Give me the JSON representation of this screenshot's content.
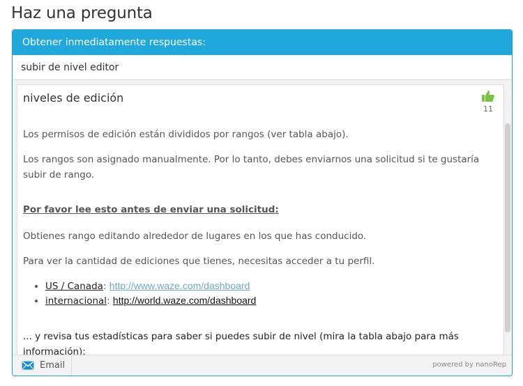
{
  "page": {
    "title": "Haz una pregunta"
  },
  "widget": {
    "header": "Obtener inmediatamente respuestas:",
    "query_value": "subir de nivel editor",
    "answer": {
      "title": "niveles de edición",
      "like_count": "11",
      "paragraphs": [
        "Los permisos de edición están divididos por rangos (ver tabla abajo).",
        "Los rangos son asignado manualmente. Por lo tanto, debes enviarnos una solicitud si te gustaría subir de rango."
      ],
      "notice": "Por favor lee esto antes de enviar una solicitud:",
      "paragraphs_after": [
        "Obtienes rango editando alrededor de lugares en los que has conducido.",
        "Para ver la cantidad de ediciones que tienes, necesitas acceder a tu perfil."
      ],
      "links": [
        {
          "label": "US / Canada",
          "separator": ": ",
          "url": "http://www.waze.com/dashboard"
        },
        {
          "label": "internacional",
          "separator": ": ",
          "url": "http://world.waze.com/dashboard"
        }
      ],
      "trailing": "... y revisa tus estadísticas para saber si puedes subir de nivel (mira la tabla abajo para más información):"
    },
    "footer": {
      "email_label": "Email",
      "powered_by": "powered by nanoRep"
    }
  },
  "colors": {
    "header_bg": "#1fa8dc",
    "like_green": "#7cc243",
    "email_icon_blue": "#1c8fc9",
    "link_blue": "#6fa7c8"
  },
  "icons": {
    "like": "thumbs-up-icon",
    "email": "envelope-icon"
  }
}
